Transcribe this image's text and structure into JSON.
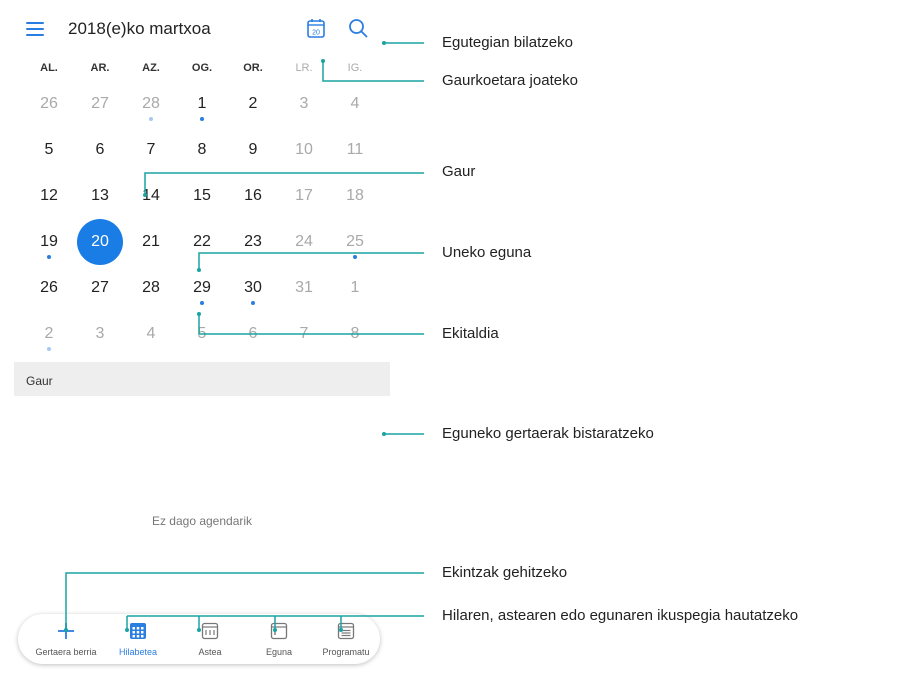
{
  "app": {
    "title": "2018(e)ko martxoa",
    "today_icon_day": "20",
    "icons": {
      "menu": "menu-icon",
      "today": "calendar-today-icon",
      "search": "search-icon"
    },
    "accent_color": "#2a7de1"
  },
  "weekdays": [
    "AL.",
    "AR.",
    "AZ.",
    "OG.",
    "OR.",
    "LR.",
    "IG."
  ],
  "weeks": [
    [
      {
        "day": "26",
        "type": "other"
      },
      {
        "day": "27",
        "type": "other"
      },
      {
        "day": "28",
        "type": "other",
        "event": "light"
      },
      {
        "day": "1",
        "event": "dot"
      },
      {
        "day": "2"
      },
      {
        "day": "3",
        "type": "weekend"
      },
      {
        "day": "4",
        "type": "weekend"
      }
    ],
    [
      {
        "day": "5"
      },
      {
        "day": "6"
      },
      {
        "day": "7"
      },
      {
        "day": "8"
      },
      {
        "day": "9"
      },
      {
        "day": "10",
        "type": "weekend"
      },
      {
        "day": "11",
        "type": "weekend"
      }
    ],
    [
      {
        "day": "12"
      },
      {
        "day": "13"
      },
      {
        "day": "14"
      },
      {
        "day": "15"
      },
      {
        "day": "16"
      },
      {
        "day": "17",
        "type": "weekend"
      },
      {
        "day": "18",
        "type": "weekend"
      }
    ],
    [
      {
        "day": "19",
        "event": "dot"
      },
      {
        "day": "20",
        "selected": true
      },
      {
        "day": "21"
      },
      {
        "day": "22"
      },
      {
        "day": "23"
      },
      {
        "day": "24",
        "type": "weekend"
      },
      {
        "day": "25",
        "type": "weekend",
        "event": "dot"
      }
    ],
    [
      {
        "day": "26"
      },
      {
        "day": "27"
      },
      {
        "day": "28"
      },
      {
        "day": "29",
        "event": "dot"
      },
      {
        "day": "30",
        "event": "dot"
      },
      {
        "day": "31",
        "type": "weekend"
      },
      {
        "day": "1",
        "type": "other"
      }
    ],
    [
      {
        "day": "2",
        "type": "other",
        "event": "light"
      },
      {
        "day": "3",
        "type": "other"
      },
      {
        "day": "4",
        "type": "other"
      },
      {
        "day": "5",
        "type": "other"
      },
      {
        "day": "6",
        "type": "other"
      },
      {
        "day": "7",
        "type": "other"
      },
      {
        "day": "8",
        "type": "other"
      }
    ]
  ],
  "today_section": {
    "header": "Gaur",
    "empty_text": "Ez dago agendarik"
  },
  "bottom_nav": [
    {
      "label": "Gertaera berria",
      "icon": "plus-icon",
      "active": false
    },
    {
      "label": "Hilabetea",
      "icon": "month-view-icon",
      "active": true
    },
    {
      "label": "Astea",
      "icon": "week-view-icon",
      "active": false
    },
    {
      "label": "Eguna",
      "icon": "day-view-icon",
      "active": false
    },
    {
      "label": "Programatu",
      "icon": "schedule-view-icon",
      "active": false
    }
  ],
  "callouts": [
    {
      "id": "search",
      "text": "Egutegian bilatzeko"
    },
    {
      "id": "goto-today",
      "text": "Gaurkoetara joateko"
    },
    {
      "id": "today",
      "text": "Gaur"
    },
    {
      "id": "current-day",
      "text": "Uneko eguna"
    },
    {
      "id": "event",
      "text": "Ekitaldia"
    },
    {
      "id": "day-events",
      "text": "Eguneko gertaerak bistaratzeko"
    },
    {
      "id": "add-events",
      "text": "Ekintzak gehitzeko"
    },
    {
      "id": "view-select",
      "text": "Hilaren, astearen edo egunaren ikuspegia hautatzeko"
    }
  ],
  "callout_color": "#1aa3a3"
}
